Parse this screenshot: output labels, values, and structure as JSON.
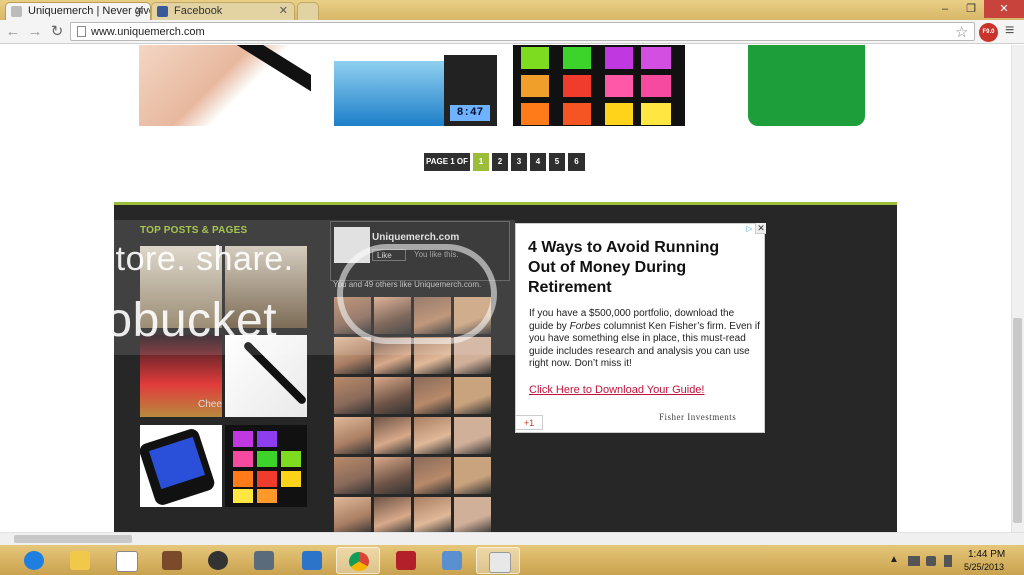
{
  "browser": {
    "tabs": [
      {
        "title": "Uniquemerch | Never give",
        "active": true
      },
      {
        "title": "Facebook",
        "active": false
      }
    ],
    "url": "www.uniquemerch.com",
    "nav": {
      "back": "←",
      "forward": "→",
      "reload": "↻"
    },
    "window_controls": {
      "minimize": "–",
      "restore": "❐",
      "close": "✕"
    },
    "bookmark_star": "☆",
    "menu_icon": "≡",
    "extension_badge": "F9.0"
  },
  "pagination": {
    "label": "PAGE 1 OF 6",
    "pages": [
      "1",
      "2",
      "3",
      "4",
      "5",
      "6"
    ],
    "current": "1"
  },
  "footer": {
    "top_posts_title": "TOP POSTS & PAGES",
    "thumb_caption": "Chee",
    "facebook": {
      "page_name": "Uniquemerch.com",
      "like_button": "Like",
      "likes_text": "You like this.",
      "others_text": "You and 49 others like Uniquemerch.com."
    }
  },
  "ad": {
    "title": "4 Ways to Avoid Running Out of Money During Retirement",
    "body_before": "If you have a $500,000 portfolio, download the guide by ",
    "body_italic": "Forbes",
    "body_after": " columnist Ken Fisher’s firm. Even if you have something else in place, this must-read guide includes research and analysis you can use right now. Don’t miss it!",
    "link": "Click Here to Download Your Guide!",
    "brand": "Fisher Investments",
    "plus_one": "+1",
    "close": "✕",
    "info": "▷"
  },
  "watermark": {
    "line1": "host. store. share.",
    "line2": "photobucket"
  },
  "taskbar": {
    "time": "1:44 PM",
    "date": "5/25/2013",
    "tray_arrow": "▲",
    "apps": [
      "internet-explorer",
      "file-explorer",
      "amazon",
      "media-app",
      "speaker-app",
      "calculator-app",
      "control-panel",
      "chrome",
      "power-app",
      "remote-app",
      "paint-app"
    ]
  },
  "colors": {
    "accent": "#9cbd3a",
    "footer_bg": "#272727",
    "ad_link": "#c0143c"
  }
}
